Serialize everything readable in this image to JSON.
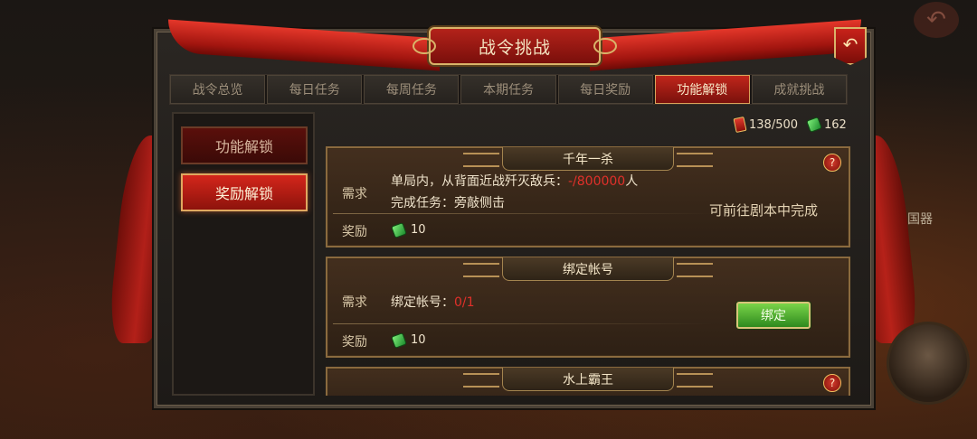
{
  "window": {
    "title": "战令挑战"
  },
  "tabs": [
    {
      "label": "战令总览"
    },
    {
      "label": "每日任务"
    },
    {
      "label": "每周任务"
    },
    {
      "label": "本期任务"
    },
    {
      "label": "每日奖励"
    },
    {
      "label": "功能解锁",
      "active": true
    },
    {
      "label": "成就挑战"
    }
  ],
  "sidebar": {
    "items": [
      {
        "label": "功能解锁"
      },
      {
        "label": "奖励解锁",
        "active": true
      }
    ]
  },
  "currency": {
    "token": "138/500",
    "jade": "162"
  },
  "background": {
    "label": "国器"
  },
  "cards": [
    {
      "title": "千年一杀",
      "req_label": "需求",
      "req_line1_prefix": "单局内，从背面近战歼灭敌兵：",
      "req_line1_value": "-/800000",
      "req_line1_suffix": "人",
      "req_line2": "完成任务：旁敲侧击",
      "reward_label": "奖励",
      "reward_value": "10",
      "action_text": "可前往剧本中完成",
      "help": "?"
    },
    {
      "title": "绑定帐号",
      "req_label": "需求",
      "req_line1_prefix": "绑定帐号：",
      "req_line1_value": "0/1",
      "reward_label": "奖励",
      "reward_value": "10",
      "button_label": "绑定"
    },
    {
      "title": "水上霸王",
      "help": "?"
    }
  ],
  "colors": {
    "accent_red": "#c0261b",
    "gold_border": "#d9b46a",
    "progress_red": "#e0302a",
    "bind_green": "#3e9a2a"
  },
  "icons": {
    "token": "red-token-icon",
    "jade": "jade-icon",
    "back": "return-arrow-icon",
    "help": "question-icon"
  }
}
